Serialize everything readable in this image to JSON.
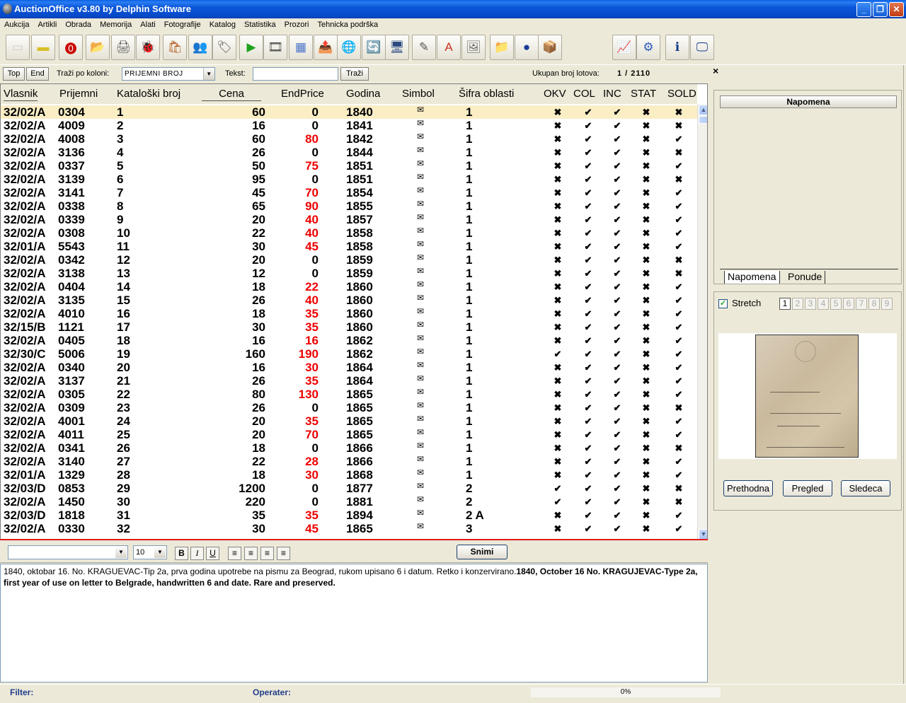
{
  "window": {
    "title": "AuctionOffice v3.80 by Delphin Software"
  },
  "menu": [
    "Aukcija",
    "Artikli",
    "Obrada",
    "Memorija",
    "Alati",
    "Fotografije",
    "Katalog",
    "Statistika",
    "Prozori",
    "Tehnicka podrška"
  ],
  "toolbar_icons": [
    "new-doc-icon",
    "folder-icon",
    "stop-icon",
    "open-icon",
    "printer-icon",
    "bug-icon",
    "bag-icon",
    "people-icon",
    "tag-icon",
    "play-icon",
    "video-icon",
    "calculator-icon",
    "ftp-icon",
    "globe-icon",
    "refresh-icon",
    "monitor-icon",
    "edit-icon",
    "font-icon",
    "picture-icon",
    "folder-open-icon",
    "info-circle-icon",
    "box-icon",
    "chart-icon",
    "settings-icon",
    "info-icon",
    "screen-icon"
  ],
  "search": {
    "top_label": "Top",
    "end_label": "End",
    "column_label": "Traži po koloni:",
    "column_value": "PRIJEMNI BROJ",
    "text_label": "Tekst:",
    "search_button": "Traži",
    "total_label": "Ukupan broj lotova:",
    "total_value": "1 / 2110",
    "close": "×"
  },
  "grid": {
    "headers": [
      "Vlasnik",
      "Prijemni",
      "Kataloški broj",
      "Cena",
      "EndPrice",
      "Godina",
      "Simbol",
      "Šifra oblasti",
      "OKV",
      "COL",
      "INC",
      "STAT",
      "SOLD"
    ],
    "rows": [
      {
        "v": "32/02/A",
        "p": "0304",
        "k": "1",
        "c": "60",
        "e": "0",
        "g": "1840",
        "s": "1",
        "m": [
          "x",
          "v",
          "v",
          "x",
          "x"
        ]
      },
      {
        "v": "32/02/A",
        "p": "4009",
        "k": "2",
        "c": "16",
        "e": "0",
        "g": "1841",
        "s": "1",
        "m": [
          "x",
          "v",
          "v",
          "x",
          "x"
        ]
      },
      {
        "v": "32/02/A",
        "p": "4008",
        "k": "3",
        "c": "60",
        "e": "80",
        "g": "1842",
        "s": "1",
        "m": [
          "x",
          "v",
          "v",
          "x",
          "v"
        ]
      },
      {
        "v": "32/02/A",
        "p": "3136",
        "k": "4",
        "c": "26",
        "e": "0",
        "g": "1844",
        "s": "1",
        "m": [
          "x",
          "v",
          "v",
          "x",
          "x"
        ]
      },
      {
        "v": "32/02/A",
        "p": "0337",
        "k": "5",
        "c": "50",
        "e": "75",
        "g": "1851",
        "s": "1",
        "m": [
          "x",
          "v",
          "v",
          "x",
          "v"
        ]
      },
      {
        "v": "32/02/A",
        "p": "3139",
        "k": "6",
        "c": "95",
        "e": "0",
        "g": "1851",
        "s": "1",
        "m": [
          "x",
          "v",
          "v",
          "x",
          "x"
        ]
      },
      {
        "v": "32/02/A",
        "p": "3141",
        "k": "7",
        "c": "45",
        "e": "70",
        "g": "1854",
        "s": "1",
        "m": [
          "x",
          "v",
          "v",
          "x",
          "v"
        ]
      },
      {
        "v": "32/02/A",
        "p": "0338",
        "k": "8",
        "c": "65",
        "e": "90",
        "g": "1855",
        "s": "1",
        "m": [
          "x",
          "v",
          "v",
          "x",
          "v"
        ]
      },
      {
        "v": "32/02/A",
        "p": "0339",
        "k": "9",
        "c": "20",
        "e": "40",
        "g": "1857",
        "s": "1",
        "m": [
          "x",
          "v",
          "v",
          "x",
          "v"
        ]
      },
      {
        "v": "32/02/A",
        "p": "0308",
        "k": "10",
        "c": "22",
        "e": "40",
        "g": "1858",
        "s": "1",
        "m": [
          "x",
          "v",
          "v",
          "x",
          "v"
        ]
      },
      {
        "v": "32/01/A",
        "p": "5543",
        "k": "11",
        "c": "30",
        "e": "45",
        "g": "1858",
        "s": "1",
        "m": [
          "x",
          "v",
          "v",
          "x",
          "v"
        ]
      },
      {
        "v": "32/02/A",
        "p": "0342",
        "k": "12",
        "c": "20",
        "e": "0",
        "g": "1859",
        "s": "1",
        "m": [
          "x",
          "v",
          "v",
          "x",
          "x"
        ]
      },
      {
        "v": "32/02/A",
        "p": "3138",
        "k": "13",
        "c": "12",
        "e": "0",
        "g": "1859",
        "s": "1",
        "m": [
          "x",
          "v",
          "v",
          "x",
          "x"
        ]
      },
      {
        "v": "32/02/A",
        "p": "0404",
        "k": "14",
        "c": "18",
        "e": "22",
        "g": "1860",
        "s": "1",
        "m": [
          "x",
          "v",
          "v",
          "x",
          "v"
        ]
      },
      {
        "v": "32/02/A",
        "p": "3135",
        "k": "15",
        "c": "26",
        "e": "40",
        "g": "1860",
        "s": "1",
        "m": [
          "x",
          "v",
          "v",
          "x",
          "v"
        ]
      },
      {
        "v": "32/02/A",
        "p": "4010",
        "k": "16",
        "c": "18",
        "e": "35",
        "g": "1860",
        "s": "1",
        "m": [
          "x",
          "v",
          "v",
          "x",
          "v"
        ]
      },
      {
        "v": "32/15/B",
        "p": "1121",
        "k": "17",
        "c": "30",
        "e": "35",
        "g": "1860",
        "s": "1",
        "m": [
          "x",
          "v",
          "v",
          "x",
          "v"
        ]
      },
      {
        "v": "32/02/A",
        "p": "0405",
        "k": "18",
        "c": "16",
        "e": "16",
        "g": "1862",
        "s": "1",
        "m": [
          "x",
          "v",
          "v",
          "x",
          "v"
        ]
      },
      {
        "v": "32/30/C",
        "p": "5006",
        "k": "19",
        "c": "160",
        "e": "190",
        "g": "1862",
        "s": "1",
        "m": [
          "v",
          "v",
          "v",
          "x",
          "v"
        ]
      },
      {
        "v": "32/02/A",
        "p": "0340",
        "k": "20",
        "c": "16",
        "e": "30",
        "g": "1864",
        "s": "1",
        "m": [
          "x",
          "v",
          "v",
          "x",
          "v"
        ]
      },
      {
        "v": "32/02/A",
        "p": "3137",
        "k": "21",
        "c": "26",
        "e": "35",
        "g": "1864",
        "s": "1",
        "m": [
          "x",
          "v",
          "v",
          "x",
          "v"
        ]
      },
      {
        "v": "32/02/A",
        "p": "0305",
        "k": "22",
        "c": "80",
        "e": "130",
        "g": "1865",
        "s": "1",
        "m": [
          "x",
          "v",
          "v",
          "x",
          "v"
        ]
      },
      {
        "v": "32/02/A",
        "p": "0309",
        "k": "23",
        "c": "26",
        "e": "0",
        "g": "1865",
        "s": "1",
        "m": [
          "x",
          "v",
          "v",
          "x",
          "x"
        ]
      },
      {
        "v": "32/02/A",
        "p": "4001",
        "k": "24",
        "c": "20",
        "e": "35",
        "g": "1865",
        "s": "1",
        "m": [
          "x",
          "v",
          "v",
          "x",
          "v"
        ]
      },
      {
        "v": "32/02/A",
        "p": "4011",
        "k": "25",
        "c": "20",
        "e": "70",
        "g": "1865",
        "s": "1",
        "m": [
          "x",
          "v",
          "v",
          "x",
          "v"
        ]
      },
      {
        "v": "32/02/A",
        "p": "0341",
        "k": "26",
        "c": "18",
        "e": "0",
        "g": "1866",
        "s": "1",
        "m": [
          "x",
          "v",
          "v",
          "x",
          "x"
        ]
      },
      {
        "v": "32/02/A",
        "p": "3140",
        "k": "27",
        "c": "22",
        "e": "28",
        "g": "1866",
        "s": "1",
        "m": [
          "x",
          "v",
          "v",
          "x",
          "v"
        ]
      },
      {
        "v": "32/01/A",
        "p": "1329",
        "k": "28",
        "c": "18",
        "e": "30",
        "g": "1868",
        "s": "1",
        "m": [
          "x",
          "v",
          "v",
          "x",
          "v"
        ]
      },
      {
        "v": "32/03/D",
        "p": "0853",
        "k": "29",
        "c": "1200",
        "e": "0",
        "g": "1877",
        "s": "2",
        "m": [
          "v",
          "v",
          "v",
          "x",
          "x"
        ]
      },
      {
        "v": "32/02/A",
        "p": "1450",
        "k": "30",
        "c": "220",
        "e": "0",
        "g": "1881",
        "s": "2",
        "m": [
          "v",
          "v",
          "v",
          "x",
          "x"
        ]
      },
      {
        "v": "32/03/D",
        "p": "1818",
        "k": "31",
        "c": "35",
        "e": "35",
        "g": "1894",
        "s": "2 A",
        "m": [
          "x",
          "v",
          "v",
          "x",
          "v"
        ]
      },
      {
        "v": "32/02/A",
        "p": "0330",
        "k": "32",
        "c": "30",
        "e": "45",
        "g": "1865",
        "s": "3",
        "m": [
          "x",
          "v",
          "v",
          "x",
          "v"
        ]
      }
    ]
  },
  "editor": {
    "font_size": "10",
    "save_button": "Snimi",
    "text_plain": "1840, oktobar 16. No. KRAGUEVAC-Tip 2a, prva godina upotrebe na pismu za Beograd, rukom upisano 6 i datum. Retko i konzervirano.",
    "text_bold": "1840, October 16 No. KRAGUJEVAC-Type 2a, first year of use on letter to Belgrade, handwritten 6 and date. Rare and preserved."
  },
  "side": {
    "napomena_title": "Napomena",
    "tabs": [
      "Napomena",
      "Ponude"
    ],
    "stretch_label": "Stretch",
    "pages": [
      "1",
      "2",
      "3",
      "4",
      "5",
      "6",
      "7",
      "8",
      "9"
    ],
    "prev_button": "Prethodna",
    "view_button": "Pregled",
    "next_button": "Sledeca"
  },
  "status": {
    "filter_label": "Filter:",
    "operator_label": "Operater:",
    "progress_text": "0%",
    "progress_value": 0
  },
  "colors": {
    "selected_row": "#fbeec5",
    "end_price_red": "#e00000",
    "title_blue": "#0b56d8"
  }
}
